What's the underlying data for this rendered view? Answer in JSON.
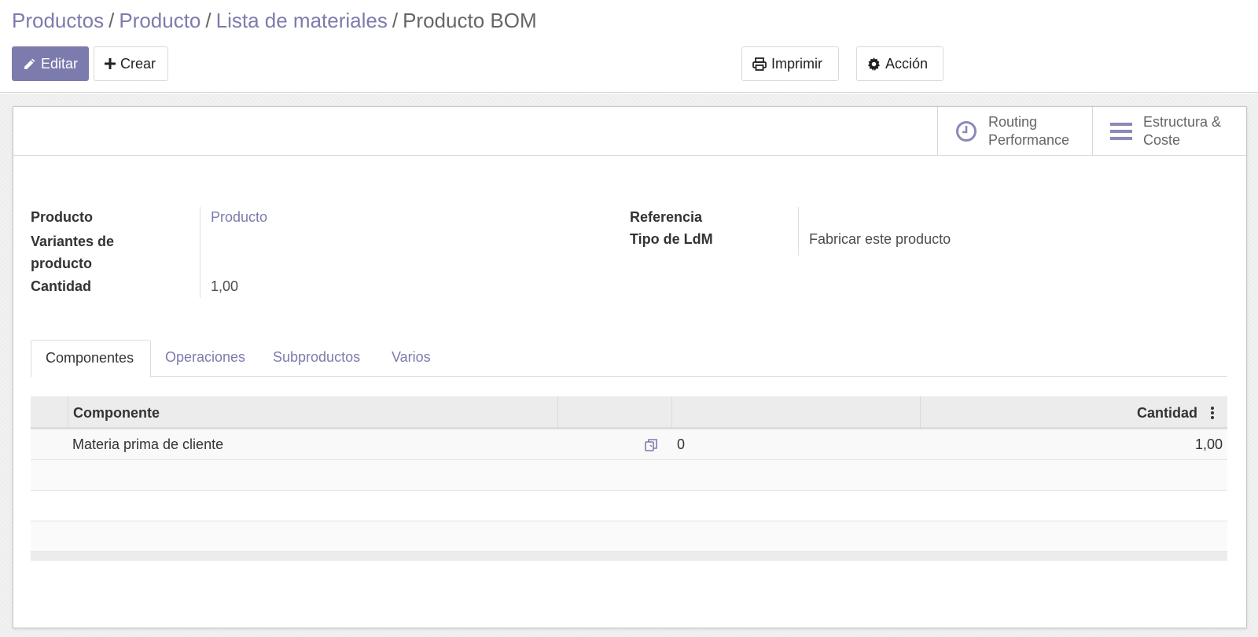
{
  "breadcrumb": {
    "items": [
      "Productos",
      "Producto",
      "Lista de materiales"
    ],
    "separator": "/",
    "current": "Producto BOM"
  },
  "toolbar": {
    "edit_label": "Editar",
    "create_label": "Crear",
    "print_label": "Imprimir",
    "action_label": "Acción"
  },
  "smart_buttons": {
    "routing": {
      "line1": "Routing",
      "line2": "Performance"
    },
    "structure": {
      "line1": "Estructura &",
      "line2": "Coste"
    }
  },
  "form": {
    "product_label": "Producto",
    "product_value": "Producto",
    "variants_label_1": "Variantes de",
    "variants_label_2": "producto",
    "quantity_label": "Cantidad",
    "quantity_value": "1,00",
    "reference_label": "Referencia",
    "bom_type_label": "Tipo de LdM",
    "bom_type_value": "Fabricar este producto"
  },
  "tabs": [
    "Componentes",
    "Operaciones",
    "Subproductos",
    "Varios"
  ],
  "table": {
    "headers": {
      "component": "Componente",
      "quantity": "Cantidad"
    },
    "rows": [
      {
        "component": "Materia prima de cliente",
        "col3": "0",
        "quantity": "1,00"
      }
    ]
  },
  "colors": {
    "brand": "#7c7bad",
    "text": "#4c4c4c"
  }
}
